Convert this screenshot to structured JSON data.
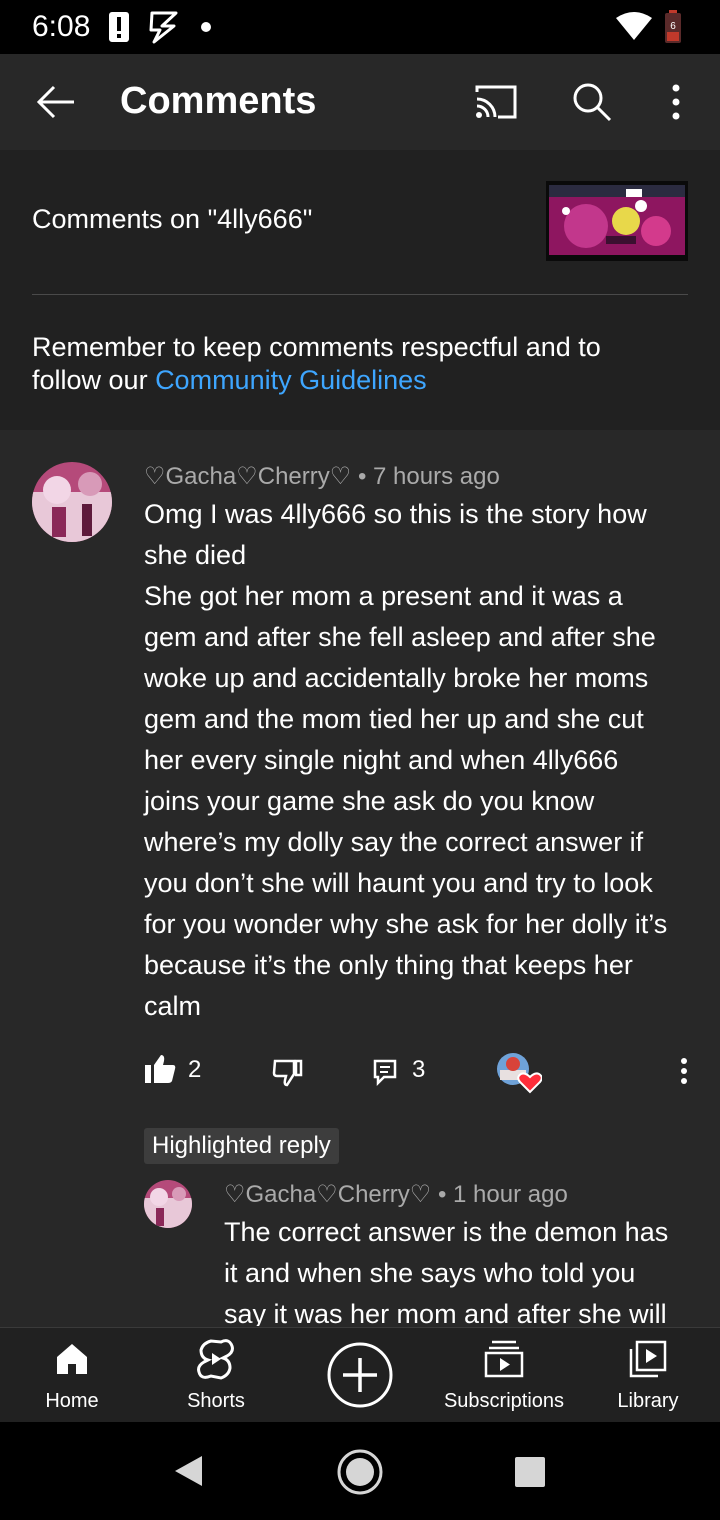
{
  "status_bar": {
    "time": "6:08",
    "battery_level": "6"
  },
  "app_bar": {
    "title": "Comments",
    "back_icon": "arrow-left-icon",
    "cast_icon": "cast-icon",
    "search_icon": "search-icon",
    "more_icon": "more-vert-icon"
  },
  "header": {
    "comments_on": "Comments on \"4lly666\""
  },
  "guidelines": {
    "text": "Remember to keep comments respectful and to follow our ",
    "link": "Community Guidelines"
  },
  "comment": {
    "author": "♡Gacha♡Cherry♡",
    "separator": "•",
    "time": "7 hours ago",
    "body": "Omg I was 4lly666 so this is the story how\nshe died\nShe got her mom a present and it was a\ngem and after she fell asleep and after she\nwoke up and accidentally broke her moms\ngem and the mom tied her up and she cut\nher every single night and when 4lly666\njoins your game she ask do you know\nwhere’s my dolly say the correct answer if\nyou don’t she will haunt you and try to look\nfor you wonder why she ask for her dolly it’s\nbecause it’s the only thing that keeps her\ncalm",
    "likes": "2",
    "replies": "3"
  },
  "highlighted": {
    "badge": "Highlighted reply",
    "author": "♡Gacha♡Cherry♡",
    "separator": "•",
    "time": "1 hour ago",
    "body": "The correct answer is the demon has\nit and when she says who told you\nsay it was her mom and after she will"
  },
  "bottom_nav": {
    "items": [
      {
        "label": "Home",
        "icon": "home-icon"
      },
      {
        "label": "Shorts",
        "icon": "shorts-icon"
      },
      {
        "label": "",
        "icon": "create-icon"
      },
      {
        "label": "Subscriptions",
        "icon": "subscriptions-icon"
      },
      {
        "label": "Library",
        "icon": "library-icon"
      }
    ]
  },
  "colors": {
    "background": "#282828",
    "header_bg": "#212121",
    "link": "#3ea6ff",
    "heart": "#ff2d3a"
  }
}
